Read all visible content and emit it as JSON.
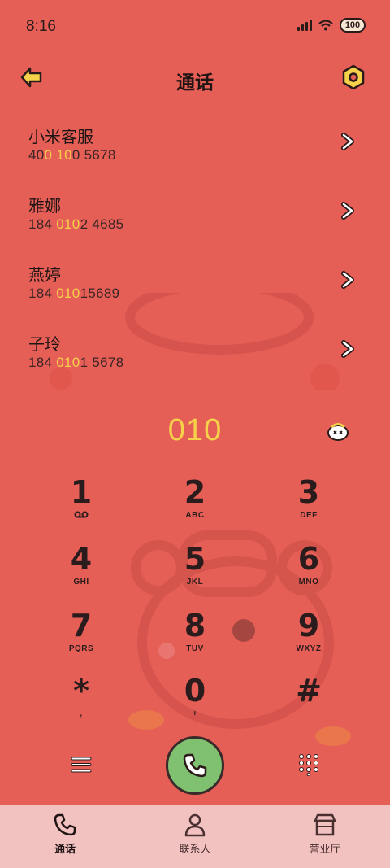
{
  "status_bar": {
    "time": "8:16",
    "battery": "100"
  },
  "header": {
    "title": "通话",
    "back_icon": "arrow-left-icon",
    "settings_icon": "hexagon-nut-icon"
  },
  "contacts": [
    {
      "name": "小米客服",
      "num_parts": [
        "40",
        "0",
        " ",
        "10",
        "0 5678"
      ]
    },
    {
      "name": "雅娜",
      "num_parts": [
        "184 ",
        "010",
        "2 4685",
        "",
        ""
      ]
    },
    {
      "name": "燕婷",
      "num_parts": [
        "184 ",
        "010",
        "15689",
        "",
        ""
      ]
    },
    {
      "name": "子玲",
      "num_parts": [
        "184 ",
        "010",
        "1 5678",
        "",
        ""
      ]
    }
  ],
  "dialer": {
    "input": "010"
  },
  "keypad": [
    {
      "digit": "1",
      "letters": ""
    },
    {
      "digit": "2",
      "letters": "ABC"
    },
    {
      "digit": "3",
      "letters": "DEF"
    },
    {
      "digit": "4",
      "letters": "GHI"
    },
    {
      "digit": "5",
      "letters": "JKL"
    },
    {
      "digit": "6",
      "letters": "MNO"
    },
    {
      "digit": "7",
      "letters": "PQRS"
    },
    {
      "digit": "8",
      "letters": "TUV"
    },
    {
      "digit": "9",
      "letters": "WXYZ"
    },
    {
      "digit": "*",
      "letters": ","
    },
    {
      "digit": "0",
      "letters": "+"
    },
    {
      "digit": "#",
      "letters": ""
    }
  ],
  "nav": [
    {
      "label": "通话",
      "icon": "phone-icon",
      "active": true
    },
    {
      "label": "联系人",
      "icon": "person-icon",
      "active": false
    },
    {
      "label": "营业厅",
      "icon": "store-icon",
      "active": false
    }
  ],
  "colors": {
    "background": "#e65f57",
    "highlight": "#f6d14a",
    "call_button": "#7fc071",
    "nav_bg": "#f2c2c0"
  }
}
